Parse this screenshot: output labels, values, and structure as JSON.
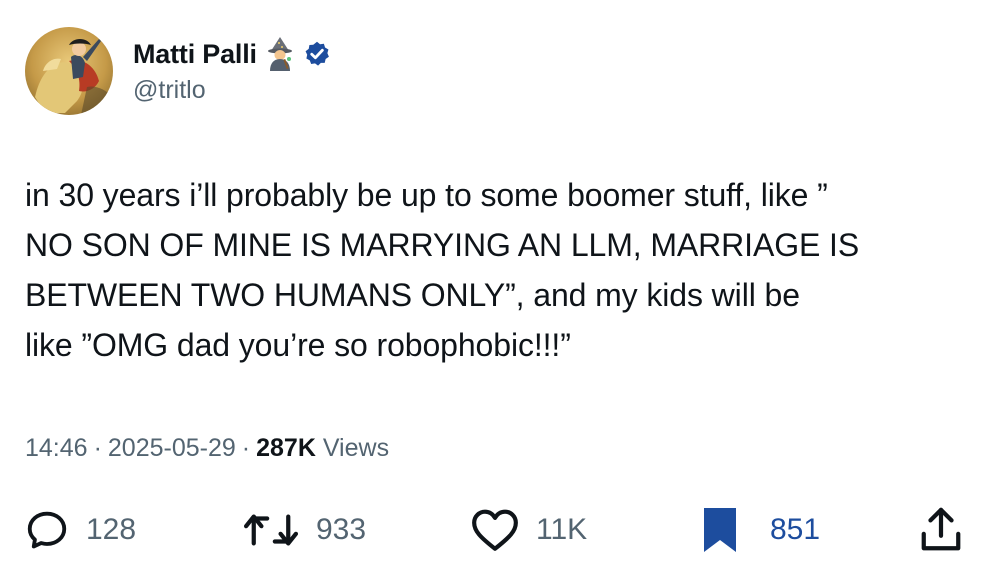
{
  "author": {
    "display_name": "Matti Palli",
    "handle": "@tritlo",
    "emoji_icon": "mage-emoji",
    "verified": true,
    "verified_color": "#1d4d9e"
  },
  "tweet": {
    "text": "in 30 years i’ll probably be up to some boomer stuff, like ”\nNO SON OF MINE IS MARRYING AN LLM, MARRIAGE IS\nBETWEEN TWO HUMANS ONLY”, and my kids will be\nlike ”OMG dad you’re so robophobic!!!”"
  },
  "meta": {
    "time": "14:46",
    "separator": "·",
    "date": "2025-05-29",
    "views_count": "287K",
    "views_label": "Views"
  },
  "actions": {
    "replies": "128",
    "reposts": "933",
    "likes": "11K",
    "bookmarks": "851",
    "bookmarked_color": "#1d4d9e",
    "icon_color": "#536471"
  }
}
